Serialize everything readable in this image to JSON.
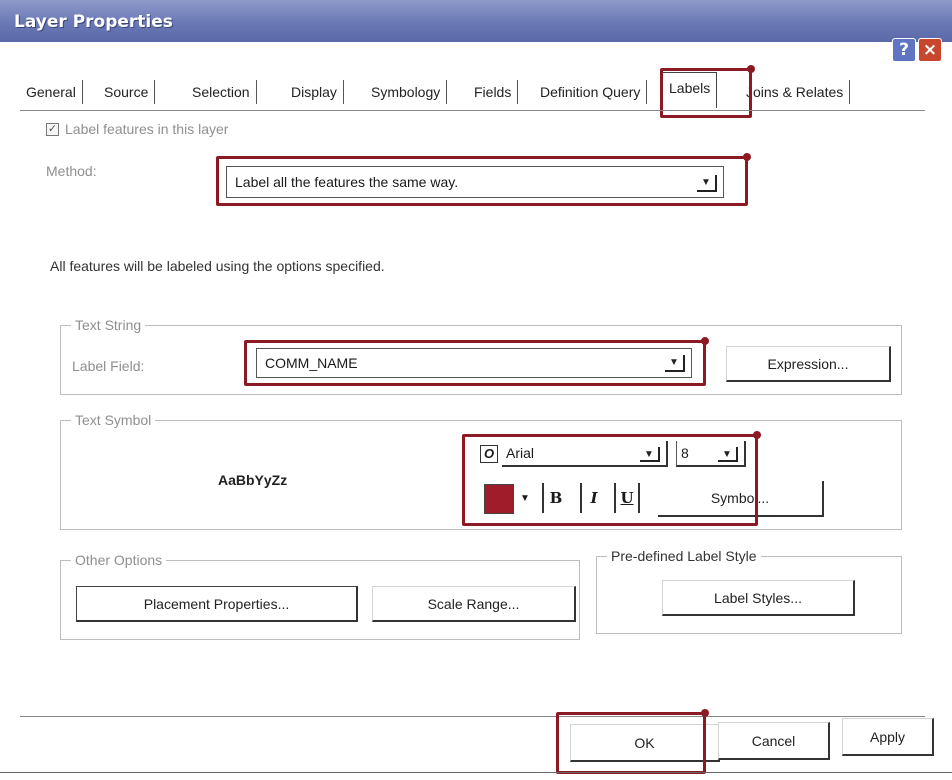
{
  "window": {
    "title": "Layer Properties",
    "help_glyph": "?",
    "close_glyph": "×"
  },
  "tabs": [
    {
      "label": "General"
    },
    {
      "label": "Source"
    },
    {
      "label": "Selection"
    },
    {
      "label": "Display"
    },
    {
      "label": "Symbology"
    },
    {
      "label": "Fields"
    },
    {
      "label": "Definition Query"
    },
    {
      "label": "Labels",
      "active": true
    },
    {
      "label": "Joins & Relates"
    }
  ],
  "labels_tab": {
    "label_features_checkbox": {
      "label": "Label features in this layer",
      "checked": true,
      "glyph": "✓"
    },
    "method_label": "Method:",
    "method_value": "Label all the features the same way.",
    "info_text": "All features will be labeled using the options specified.",
    "text_string": {
      "group_title": "Text String",
      "label_field_label": "Label Field:",
      "label_field_value": "COMM_NAME",
      "expression_button": "Expression..."
    },
    "text_symbol": {
      "group_title": "Text Symbol",
      "preview_text": "AaBbYyZz",
      "font_icon_glyph": "O",
      "font_name": "Arial",
      "font_size": "8",
      "color": "#a01c2b",
      "bold_glyph": "B",
      "italic_glyph": "I",
      "underline_glyph": "U",
      "symbol_button": "Symbol..."
    },
    "other_options": {
      "group_title": "Other Options",
      "placement_button": "Placement Properties...",
      "scale_range_button": "Scale Range..."
    },
    "predefined_style": {
      "group_title": "Pre-defined Label Style",
      "label_styles_button": "Label Styles..."
    }
  },
  "footer": {
    "ok_button": "OK",
    "cancel_button": "Cancel",
    "apply_button": "Apply"
  },
  "highlight_color": "#8c1a24",
  "combo_arrow_glyph": "▼"
}
